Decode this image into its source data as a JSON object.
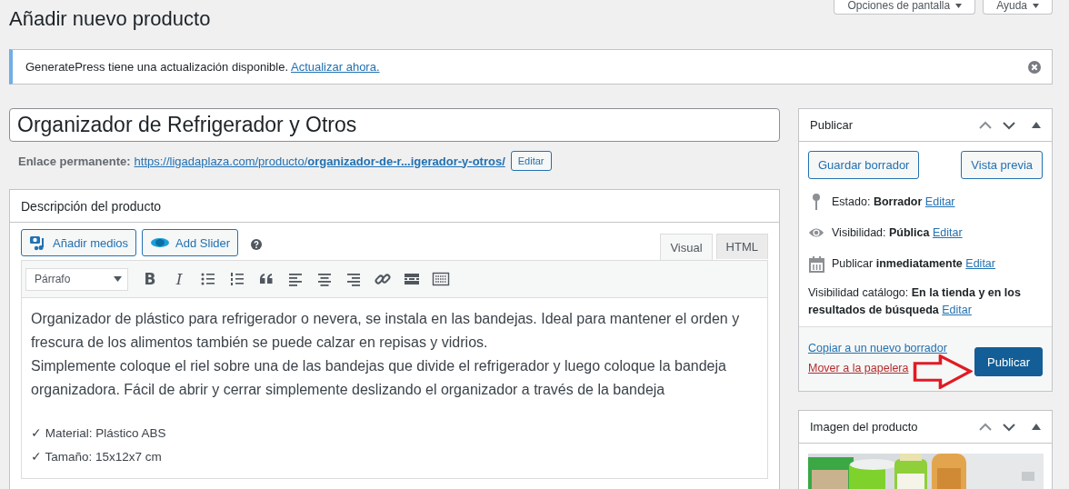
{
  "page_title": "Añadir nuevo producto",
  "header_buttons": [
    {
      "label": "Opciones de pantalla"
    },
    {
      "label": "Ayuda"
    }
  ],
  "notice": {
    "text": "GeneratePress tiene una actualización disponible.",
    "link": "Actualizar ahora."
  },
  "post_title": {
    "value": "Organizador de Refrigerador y Otros"
  },
  "permalink": {
    "label": "Enlace permanente:",
    "url": "https://ligadaplaza.com/producto/**organizador-de-r...igerador-y-otros/**",
    "edit_button": "Editar"
  },
  "description_box": {
    "title": "Descripción del producto",
    "media_buttons": [
      {
        "kind": "media",
        "label": "Añadir medios"
      },
      {
        "kind": "slider",
        "label": "Add Slider"
      }
    ],
    "editor_tabs": [
      {
        "label": "Visual",
        "selected": true
      },
      {
        "label": "HTML",
        "selected": false
      }
    ],
    "format_select": {
      "value": "Párrafo"
    },
    "toolbar": [
      {
        "kind": "bold",
        "label": "B"
      },
      {
        "kind": "italic",
        "label": "I"
      },
      {
        "kind": "bullets"
      },
      {
        "kind": "numbers"
      },
      {
        "kind": "quote"
      },
      {
        "kind": "align-left"
      },
      {
        "kind": "align-center"
      },
      {
        "kind": "align-right"
      },
      {
        "kind": "link"
      },
      {
        "kind": "more"
      },
      {
        "kind": "toolbar-toggle"
      }
    ],
    "paragraphs": [
      "Organizador de plástico para refrigerador o nevera, se instala en las bandejas. Ideal para mantener el orden y frescura de los alimentos también se puede calzar en repisas y vidrios.",
      "Simplemente coloque el riel sobre una de las bandejas que divide el refrigerador y luego coloque la bandeja organizadora. Fácil de abrir y cerrar simplemente deslizando el organizador a través de la bandeja"
    ],
    "specs": [
      "✓ Material: Plástico ABS",
      "✓ Tamaño: 15x12x7 cm"
    ]
  },
  "publish_box": {
    "title": "Publicar",
    "buttons": [
      "Guardar borrador",
      "Vista previa"
    ],
    "rows": [
      {
        "kind": "status",
        "label": "Estado:",
        "value": "Borrador",
        "link": "Editar"
      },
      {
        "kind": "visibility",
        "label": "Visibilidad:",
        "value": "Pública",
        "link": "Editar"
      },
      {
        "kind": "schedule",
        "label": "Publicar",
        "value": "inmediatamente",
        "link": "Editar"
      }
    ],
    "catalog": {
      "label": "Visibilidad catálogo:",
      "value": "En la tienda y en los resultados de búsqueda",
      "link": "Editar"
    },
    "copy_link": "Copiar a un nuevo borrador",
    "trash_link": "Mover a la papelera",
    "publish_button": "Publicar"
  },
  "image_box": {
    "title": "Imagen del producto"
  }
}
